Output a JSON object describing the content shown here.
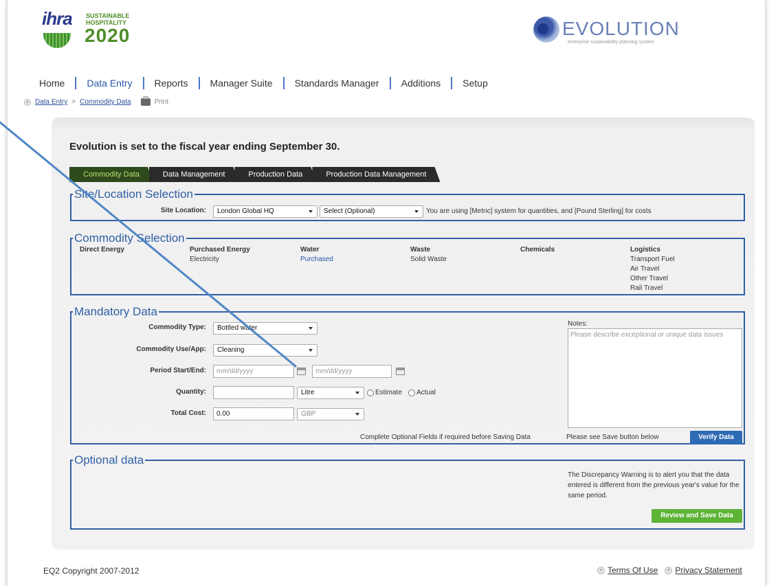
{
  "header": {
    "ihra_text": "ihra",
    "sustainable_text": "SUSTAINABLE\nHOSPITALITY",
    "year_text": "2020",
    "evo_name": "EVOLUTION",
    "evo_tagline": "enterprise sustainability planning system"
  },
  "nav": {
    "items": [
      "Home",
      "Data Entry",
      "Reports",
      "Manager Suite",
      "Standards Manager",
      "Additions",
      "Setup"
    ],
    "active": "Data Entry"
  },
  "breadcrumb": {
    "bullet": "»",
    "link1": "Data Entry",
    "sep": ">",
    "link2": "Commodity Data",
    "print": "Print"
  },
  "main": {
    "fiscal_notice": "Evolution is set to the fiscal year ending September 30.",
    "tabs": [
      "Commodity Data",
      "Data Management",
      "Production Data",
      "Production Data Management"
    ]
  },
  "site": {
    "legend": "Site/Location Selection",
    "label": "Site Location:",
    "location_value": "London Global HQ",
    "optional_value": "Select (Optional)",
    "system_note": "You are using [Metric] system for quantities, and [Pound Sterling] for costs"
  },
  "commodity": {
    "legend": "Commodity Selection",
    "columns": [
      {
        "head": "Direct Energy",
        "items": []
      },
      {
        "head": "Purchased Energy",
        "items": [
          "Electricity"
        ]
      },
      {
        "head": "Water",
        "items": [
          "Purchased"
        ]
      },
      {
        "head": "Waste",
        "items": [
          "Solid Waste"
        ]
      },
      {
        "head": "Chemicals",
        "items": []
      },
      {
        "head": "Logistics",
        "items": [
          "Transport Fuel",
          "Air Travel",
          "Other Travel",
          "Rail Travel"
        ]
      }
    ]
  },
  "mandatory": {
    "legend": "Mandatory Data",
    "type_label": "Commodity Type:",
    "type_value": "Bottled water",
    "use_label": "Commodity Use/App:",
    "use_value": "Cleaning",
    "period_label": "Period Start/End:",
    "start_placeholder": "mm/dd/yyyy",
    "end_placeholder": "mm/dd/yyyy",
    "quantity_label": "Quantity:",
    "quantity_value": "",
    "unit_value": "Litre",
    "estimate_label": "Estimate",
    "actual_label": "Actual",
    "cost_label": "Total Cost:",
    "cost_value": "0.00",
    "currency_value": "GBP",
    "notes_label": "Notes:",
    "notes_placeholder": "Please describe exceptional or unique data issues",
    "complete_note": "Complete Optional Fields if required before Saving Data",
    "save_note": "Please see Save button below",
    "verify_button": "Verify Data"
  },
  "optional": {
    "legend": "Optional data",
    "discrepancy_note": "The Discrepancy Warning is to alert you that the data entered is different from the previous year's value for the same period.",
    "save_button": "Review and Save Data"
  },
  "footer": {
    "copyright": "EQ2 Copyright 2007-2012",
    "terms": "Terms Of Use",
    "privacy": "Privacy Statement",
    "bullet": "»"
  },
  "colors": {
    "accent_blue": "#2f5fa5",
    "button_blue": "#2f6ab5",
    "button_green": "#5cb335",
    "active_tab": "#2e4a1c"
  }
}
